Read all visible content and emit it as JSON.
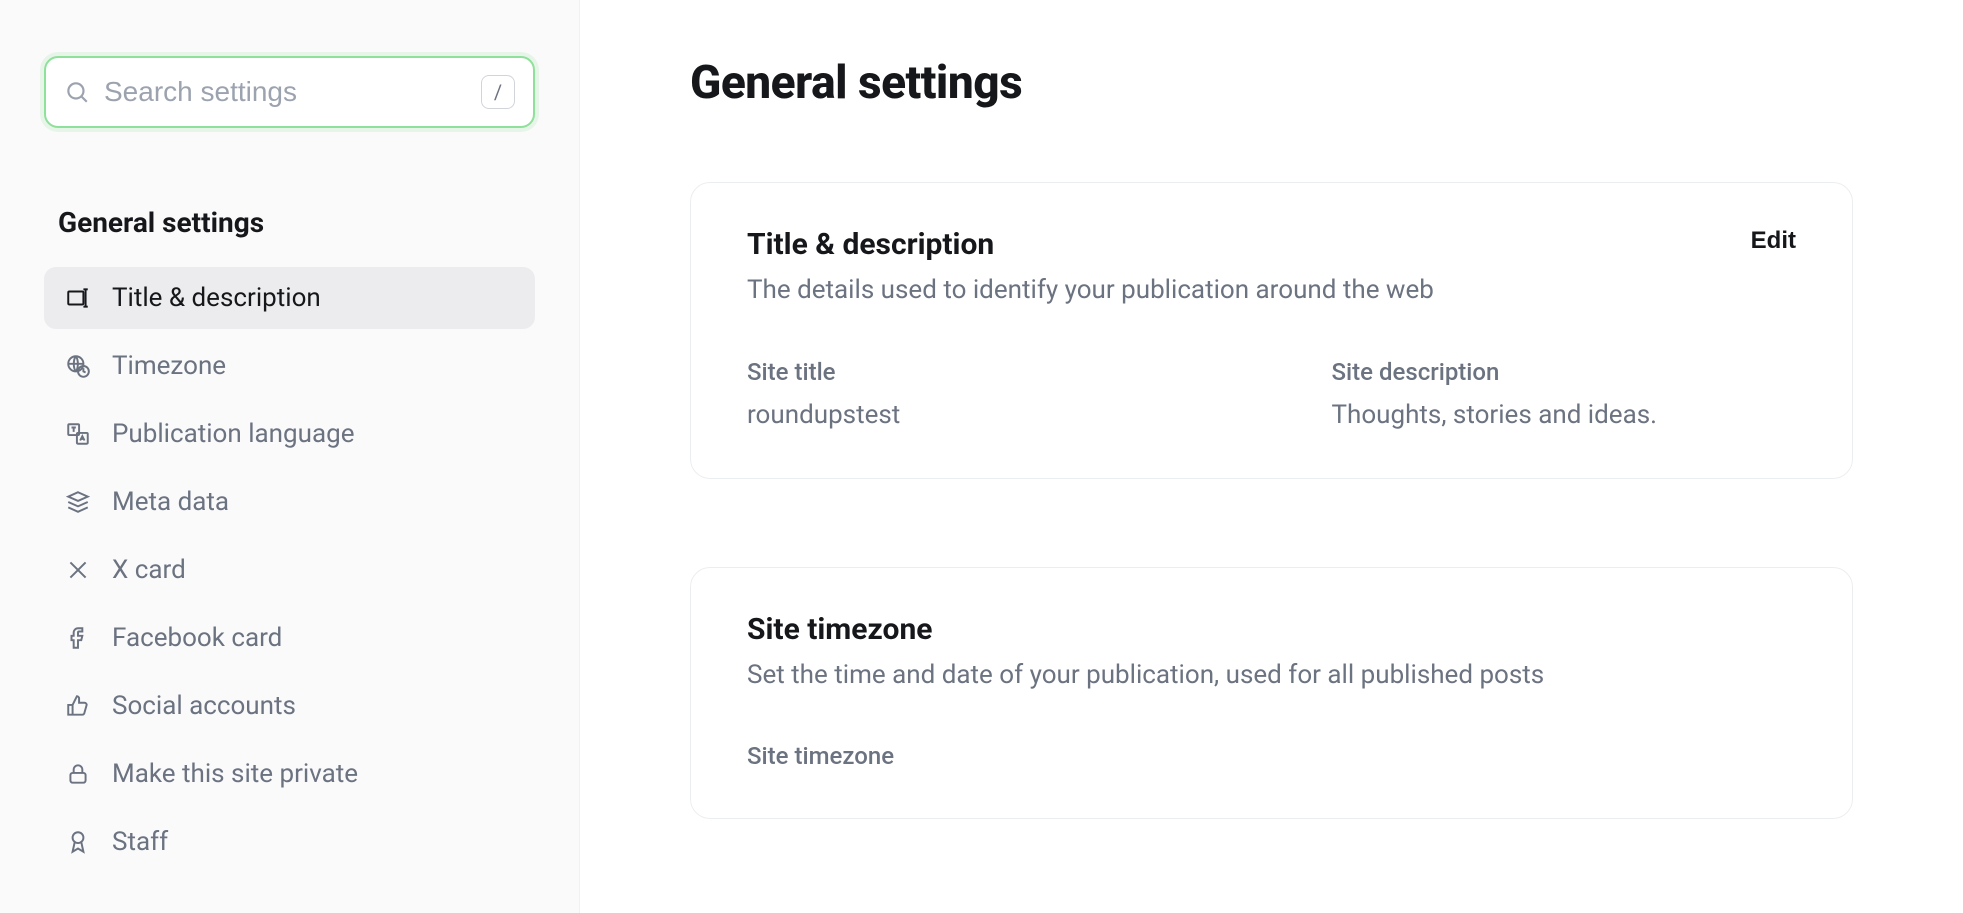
{
  "sidebar": {
    "search": {
      "placeholder": "Search settings",
      "kbd": "/"
    },
    "section_title": "General settings",
    "items": [
      {
        "id": "title-description",
        "label": "Title & description",
        "active": true
      },
      {
        "id": "timezone",
        "label": "Timezone",
        "active": false
      },
      {
        "id": "publication-language",
        "label": "Publication language",
        "active": false
      },
      {
        "id": "meta-data",
        "label": "Meta data",
        "active": false
      },
      {
        "id": "x-card",
        "label": "X card",
        "active": false
      },
      {
        "id": "facebook-card",
        "label": "Facebook card",
        "active": false
      },
      {
        "id": "social-accounts",
        "label": "Social accounts",
        "active": false
      },
      {
        "id": "make-private",
        "label": "Make this site private",
        "active": false
      },
      {
        "id": "staff",
        "label": "Staff",
        "active": false
      }
    ]
  },
  "main": {
    "page_title": "General settings",
    "cards": {
      "title_desc": {
        "title": "Title & description",
        "subtitle": "The details used to identify your publication around the web",
        "edit_label": "Edit",
        "fields": {
          "site_title": {
            "label": "Site title",
            "value": "roundupstest"
          },
          "site_description": {
            "label": "Site description",
            "value": "Thoughts, stories and ideas."
          }
        }
      },
      "timezone": {
        "title": "Site timezone",
        "subtitle": "Set the time and date of your publication, used for all published posts",
        "fields": {
          "site_timezone": {
            "label": "Site timezone"
          }
        }
      }
    }
  }
}
